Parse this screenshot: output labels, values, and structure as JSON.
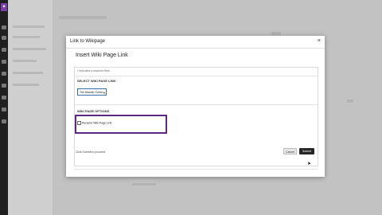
{
  "app": {
    "logo_glyph": "✦"
  },
  "modal": {
    "title": "Link to Wikipage",
    "close_glyph": "×",
    "heading": "Insert Wiki Page Link",
    "required_note": "* Indicates a required field.",
    "select_section_label": "SELECT WIKI PAGE LINK",
    "selected_page": "The Atlantic Ocean",
    "options_section_label": "WIKI PAGE OPTIONS",
    "rename_option_label": "Rename Wiki Page Link",
    "status_text": "Click Submit to proceed.",
    "cancel_label": "Cancel",
    "submit_label": "Submit"
  },
  "colors": {
    "accent": "#5b2a7a",
    "select_border": "#3b6ea8",
    "submit_bg": "#262626",
    "logo": "#7b3fa8"
  }
}
